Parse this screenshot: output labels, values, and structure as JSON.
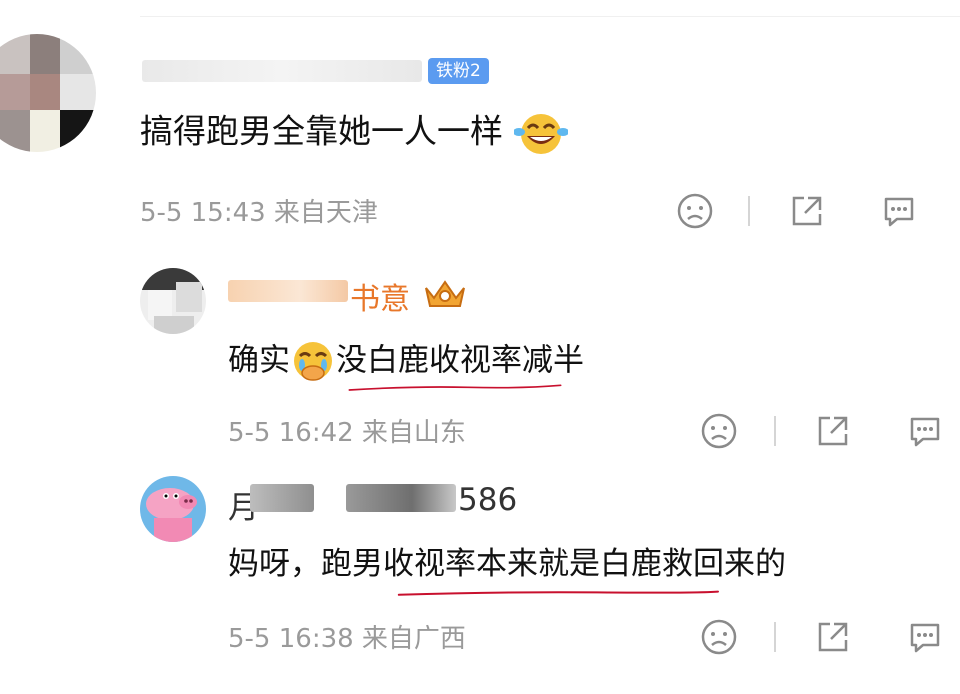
{
  "colors": {
    "underline": "#c8102e",
    "badge": "#5b9bf0",
    "meta": "#9a9a9a"
  },
  "top_comment": {
    "badge": "铁粉2",
    "text": "搞得跑男全靠她一人一样",
    "emoji": "laugh-cry-emoji",
    "meta": "5-5 15:43 来自天津"
  },
  "reply1": {
    "username_visible": "书意",
    "crown_icon": "crown-badge-icon",
    "text_before_emoji": "确实",
    "emoji": "crying-covering-mouth-emoji",
    "text_after_emoji": "没白鹿收视率减半",
    "meta": "5-5 16:42 来自山东"
  },
  "reply2": {
    "username_prefix": "月",
    "username_suffix": "586",
    "text": "妈呀，跑男收视率本来就是白鹿救回来的",
    "meta": "5-5 16:38 来自广西"
  },
  "icons": [
    "dislike-face-icon",
    "share-icon",
    "comment-icon"
  ]
}
